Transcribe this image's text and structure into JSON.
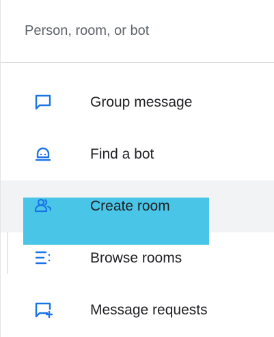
{
  "search": {
    "placeholder": "Person, room, or bot",
    "value": ""
  },
  "menu": {
    "items": [
      {
        "label": "Group message",
        "icon": "chat-bubble-icon"
      },
      {
        "label": "Find a bot",
        "icon": "bot-icon"
      },
      {
        "label": "Create room",
        "icon": "create-room-icon"
      },
      {
        "label": "Browse rooms",
        "icon": "browse-rooms-icon"
      },
      {
        "label": "Message requests",
        "icon": "message-requests-icon"
      }
    ]
  },
  "colors": {
    "icon": "#1a73e8",
    "highlight": "#3fc2e6",
    "hover_row": "#f1f3f4",
    "text": "#202124",
    "placeholder": "#5f6368"
  }
}
